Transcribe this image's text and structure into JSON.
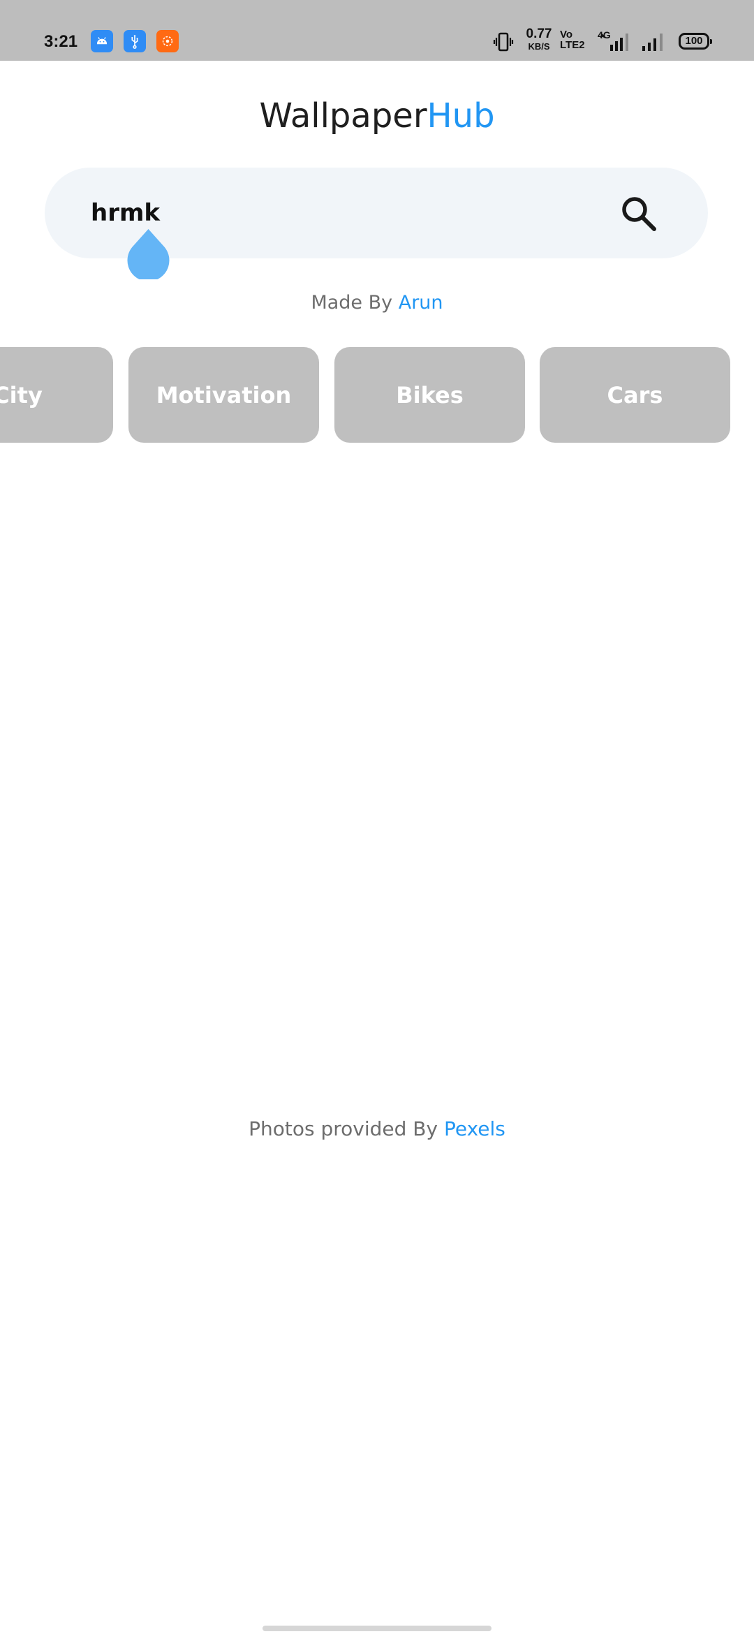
{
  "status_bar": {
    "time": "3:21",
    "notification_icons": [
      "android-icon",
      "usb-icon",
      "screen-recorder-icon"
    ],
    "net_speed_value": "0.77",
    "net_speed_unit": "KB/S",
    "volte_top": "Vo",
    "volte_bottom": "LTE2",
    "network_type": "4G",
    "battery": "100",
    "background_color": "#bdbdbd"
  },
  "app": {
    "title_part1": "Wallpaper",
    "title_part2": "Hub",
    "accent_color": "#2196f3"
  },
  "search": {
    "value": "hrmk",
    "button_icon": "search-icon",
    "background_color": "#f1f5f9"
  },
  "made_by": {
    "prefix": "Made By",
    "author": "Arun"
  },
  "categories": [
    {
      "label": "City"
    },
    {
      "label": "Motivation"
    },
    {
      "label": "Bikes"
    },
    {
      "label": "Cars"
    }
  ],
  "credit": {
    "prefix": "Photos provided By",
    "provider": "Pexels"
  }
}
